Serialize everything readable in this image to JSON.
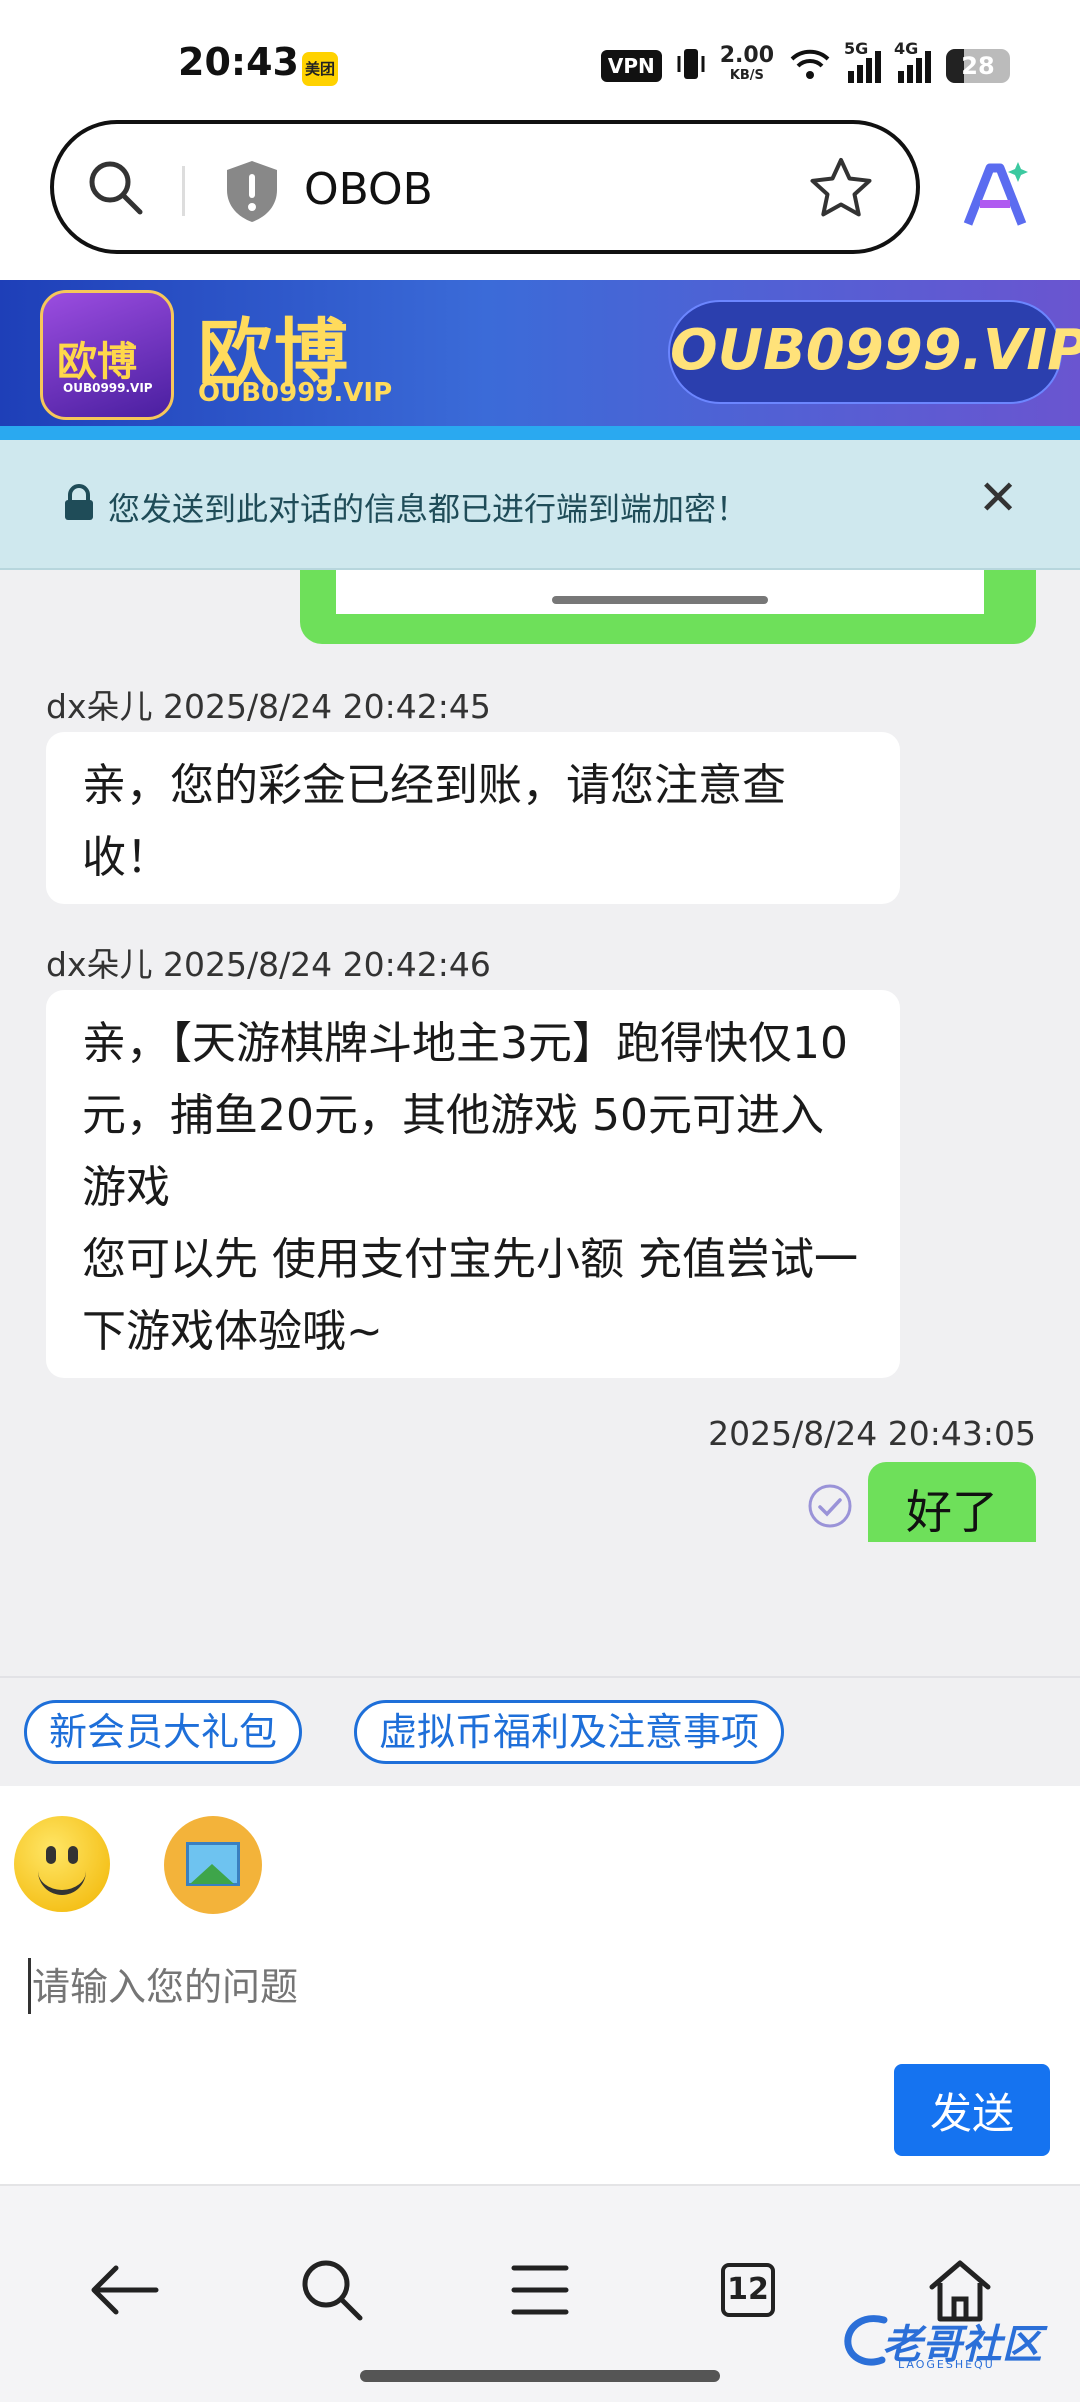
{
  "status_bar": {
    "time": "20:43",
    "app_badge": "美团",
    "vpn": "VPN",
    "speed": "2.00",
    "speed_unit": "KB/S",
    "net1": "5G",
    "net2": "4G",
    "battery": "28"
  },
  "address_bar": {
    "url_text": "OBOB"
  },
  "banner": {
    "logo_text": "欧博",
    "logo_sub": "OUB0999.VIP",
    "brand_cn": "欧博",
    "brand_en": "OUB0999.VIP",
    "pill_text": "OUB0999.VIP"
  },
  "notice": {
    "text": "您发送到此对话的信息都已进行端到端加密！",
    "close": "✕"
  },
  "messages": [
    {
      "sender_meta": "dx朵儿 2025/8/24 20:42:45",
      "text": "亲，您的彩金已经到账，请您注意查收！"
    },
    {
      "sender_meta": "dx朵儿 2025/8/24 20:42:46",
      "text": "亲，【天游棋牌斗地主3元】跑得快仅10元，捕鱼20元，其他游戏 50元可进入游戏\n您可以先 使用支付宝先小额 充值尝试一下游戏体验哦~"
    }
  ],
  "sent_message": {
    "meta": "2025/8/24 20:43:05",
    "text": "好了"
  },
  "quick_replies": [
    "新会员大礼包",
    "虚拟币福利及注意事项"
  ],
  "composer": {
    "placeholder": "请输入您的问题",
    "send_label": "发送"
  },
  "bottom_nav": {
    "tab_count": "12"
  },
  "watermark": {
    "text": "老哥社区",
    "sub": "LAOGESHEQU"
  },
  "colors": {
    "accent": "#1573f0",
    "sent_bubble": "#6ee05a",
    "notice_bg": "#cfe8ee"
  }
}
